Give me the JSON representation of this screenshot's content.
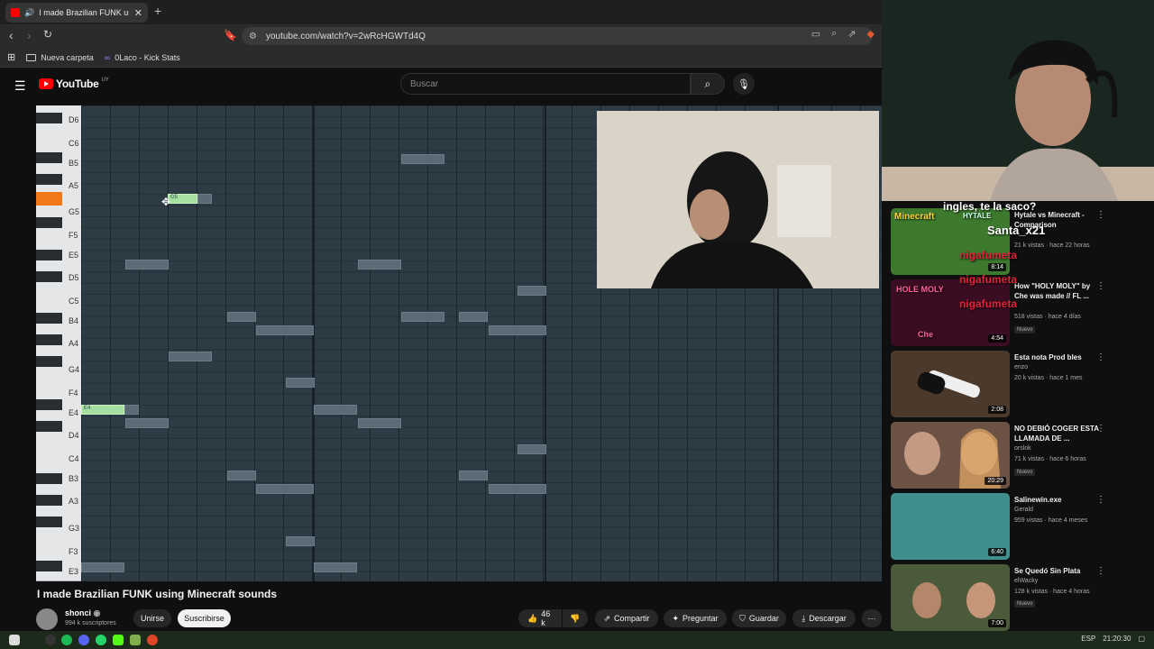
{
  "browser": {
    "tab_title": "I made Brazilian FUNK using",
    "new_tab": "+",
    "url": "youtube.com/watch?v=2wRcHGWTd4Q",
    "bookmarks": [
      "Nueva carpeta",
      "0Laco - Kick Stats"
    ]
  },
  "youtube": {
    "logo": "YouTube",
    "logo_country": "UY",
    "search_placeholder": "Buscar"
  },
  "video": {
    "title": "I made Brazilian FUNK using Minecraft sounds",
    "channel": "shonci",
    "subscribers": "994 k suscriptores",
    "join_label": "Unirse",
    "subscribe_label": "Suscribirse",
    "likes": "46 k",
    "share_label": "Compartir",
    "ask_label": "Preguntar",
    "save_label": "Guardar",
    "download_label": "Descargar"
  },
  "piano_roll": {
    "key_labels": [
      "D6",
      "C6",
      "B5",
      "A5",
      "G5",
      "F5",
      "E5",
      "D5",
      "C5",
      "B4",
      "A4",
      "G4",
      "F4",
      "E4",
      "D4",
      "C4",
      "B3",
      "A3",
      "G3",
      "F3",
      "E3"
    ],
    "note_labels": [
      "G5",
      "E4"
    ]
  },
  "recommendations": [
    {
      "title": "Hytale vs Minecraft - Comparison",
      "channel": "",
      "meta": "21 k vistas · hace 22 horas",
      "duration": "8:14",
      "new": ""
    },
    {
      "title": "How \"HOLY MOLY\" by Che was made // FL ...",
      "channel": "",
      "meta": "518 vistas · hace 4 días",
      "duration": "4:54",
      "new": "Nuevo"
    },
    {
      "title": "Esta nota Prod bles",
      "channel": "enzo",
      "meta": "20 k vistas · hace 1 mes",
      "duration": "2:08",
      "new": ""
    },
    {
      "title": "NO DEBIÓ COGER ESTA LLAMADA DE ...",
      "channel": "orslok",
      "meta": "71 k vistas · hace 6 horas",
      "duration": "20:29",
      "new": "Nuevo"
    },
    {
      "title": "Salinewin.exe",
      "channel": "Gerald",
      "meta": "959 vistas · hace 4 meses",
      "duration": "6:40",
      "new": ""
    },
    {
      "title": "Se Quedó Sin Plata",
      "channel": "elWacky",
      "meta": "128 k vistas · hace 4 horas",
      "duration": "7:00",
      "new": "Nuevo"
    }
  ],
  "overlay_chat": {
    "line1": "ingles, te la saco?",
    "user1": "Santa_x21",
    "user2": "nigafumeta",
    "thumb_text_1": "Minecraft",
    "thumb_text_2": "HYTALE",
    "thumb_text_3": "HOLE MOLY",
    "thumb_text_4": "Che"
  },
  "taskbar": {
    "lang": "ESP",
    "time": "21:20:30"
  }
}
